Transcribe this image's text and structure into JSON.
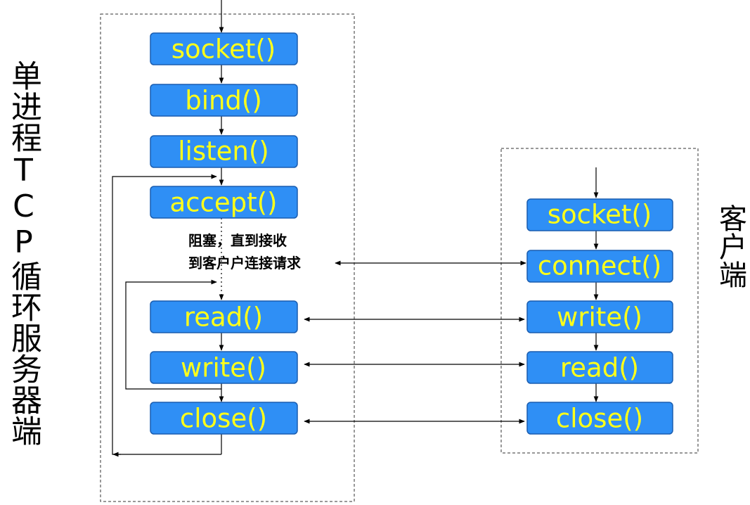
{
  "server_label": "单进程TCP循环服务器端",
  "client_label": "客户端",
  "server_steps": [
    "socket()",
    "bind()",
    "listen()",
    "accept()",
    "read()",
    "write()",
    "close()"
  ],
  "client_steps": [
    "socket()",
    "connect()",
    "write()",
    "read()",
    "close()"
  ],
  "block_note": {
    "line1": "阻塞，直到接收",
    "line2": "到客户户连接请求"
  }
}
